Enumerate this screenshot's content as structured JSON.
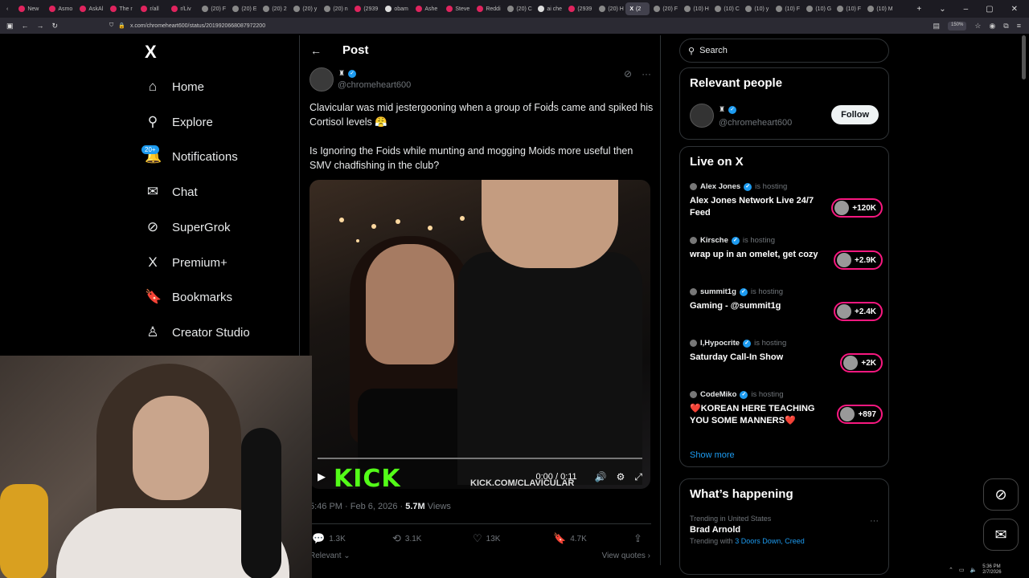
{
  "browser": {
    "tabs": [
      {
        "label": "New",
        "color": "#e0245e"
      },
      {
        "label": "Asmo",
        "color": "#e0245e"
      },
      {
        "label": "AskAl",
        "color": "#e0245e"
      },
      {
        "label": "The r",
        "color": "#e0245e"
      },
      {
        "label": "r/all",
        "color": "#e0245e"
      },
      {
        "label": "r/Liv",
        "color": "#e0245e"
      },
      {
        "label": "(20) F",
        "color": "#888888"
      },
      {
        "label": "(20) E",
        "color": "#888888"
      },
      {
        "label": "(20) 2",
        "color": "#888888"
      },
      {
        "label": "(20) y",
        "color": "#888888"
      },
      {
        "label": "(20) n",
        "color": "#888888"
      },
      {
        "label": "(2939",
        "color": "#e0245e"
      },
      {
        "label": "obam",
        "color": "#dddddd"
      },
      {
        "label": "Ashe",
        "color": "#e0245e"
      },
      {
        "label": "Steve",
        "color": "#e0245e"
      },
      {
        "label": "Reddi",
        "color": "#e0245e"
      },
      {
        "label": "(20) C",
        "color": "#888888"
      },
      {
        "label": "ai che",
        "color": "#dddddd"
      },
      {
        "label": "(2939",
        "color": "#e0245e"
      },
      {
        "label": "(20) H",
        "color": "#888888"
      }
    ],
    "active_tab": "(2",
    "tabs_after": [
      {
        "label": "(20) F",
        "color": "#888888"
      },
      {
        "label": "(10) H",
        "color": "#888888"
      },
      {
        "label": "(10) C",
        "color": "#888888"
      },
      {
        "label": "(10) y",
        "color": "#888888"
      },
      {
        "label": "(10) F",
        "color": "#888888"
      },
      {
        "label": "(10) G",
        "color": "#888888"
      },
      {
        "label": "(10) F",
        "color": "#888888"
      },
      {
        "label": "(10) M",
        "color": "#888888"
      }
    ],
    "url": "x.com/chromeheart600/status/2019920668087972200",
    "zoom": "150%"
  },
  "sidebar": {
    "logo": "X",
    "items": [
      {
        "label": "Home",
        "icon": "⌂"
      },
      {
        "label": "Explore",
        "icon": "⚲"
      },
      {
        "label": "Notifications",
        "icon": "🔔"
      },
      {
        "label": "Chat",
        "icon": "✉"
      },
      {
        "label": "SuperGrok",
        "icon": "⊘"
      },
      {
        "label": "Premium+",
        "icon": "X"
      },
      {
        "label": "Bookmarks",
        "icon": "🔖"
      },
      {
        "label": "Creator Studio",
        "icon": "♙"
      }
    ],
    "notif_badge": "20+"
  },
  "post": {
    "header": "Post",
    "handle": "@chromeheart600",
    "text1": "Clavicular was mid jestergooning when a group of Foids came and spiked his Cortisol levels 😤",
    "text2": "Is Ignoring the Foids while munting and mogging Moids more useful then SMV chadfishing in the club?",
    "video": {
      "watermark": "KICK",
      "watermark_url": "KICK.COM/CLAVICULAR",
      "time": "0:00 / 0:11",
      "progress": 0
    },
    "timestamp": "5:46 PM · Feb 6, 2026 ·",
    "views": "5.7M",
    "views_label": "Views",
    "replies": "1.3K",
    "reposts": "3.1K",
    "likes": "13K",
    "bookmarks": "4.7K",
    "relevant": "Relevant ⌄",
    "view_quotes": "View quotes ›"
  },
  "right": {
    "search_placeholder": "Search",
    "relevant_people": {
      "title": "Relevant people",
      "handle": "@chromeheart600",
      "follow": "Follow"
    },
    "live": {
      "title": "Live on X",
      "entries": [
        {
          "host": "Alex Jones",
          "hosting": "is hosting",
          "title": "Alex Jones Network Live 24/7 Feed",
          "count": "+120K"
        },
        {
          "host": "Kirsche",
          "hosting": "is hosting",
          "title": "wrap up in an omelet, get cozy",
          "count": "+2.9K"
        },
        {
          "host": "summit1g",
          "hosting": "is hosting",
          "title": "Gaming - @summit1g",
          "count": "+2.4K"
        },
        {
          "host": "I,Hypocrite",
          "hosting": "is hosting",
          "title": "Saturday Call-In Show",
          "count": "+2K"
        },
        {
          "host": "CodeMiko",
          "hosting": "is hosting",
          "title": "❤️KOREAN HERE TEACHING YOU SOME MANNERS❤️",
          "count": "+897"
        }
      ],
      "show_more": "Show more"
    },
    "happening": {
      "title": "What’s happening",
      "trend_location": "Trending in United States",
      "trend_name": "Brad Arnold",
      "trend_with": "Trending with",
      "trend_links": "3 Doors Down, Creed"
    }
  },
  "taskbar": {
    "time": "5:36 PM",
    "date": "2/7/2026"
  }
}
